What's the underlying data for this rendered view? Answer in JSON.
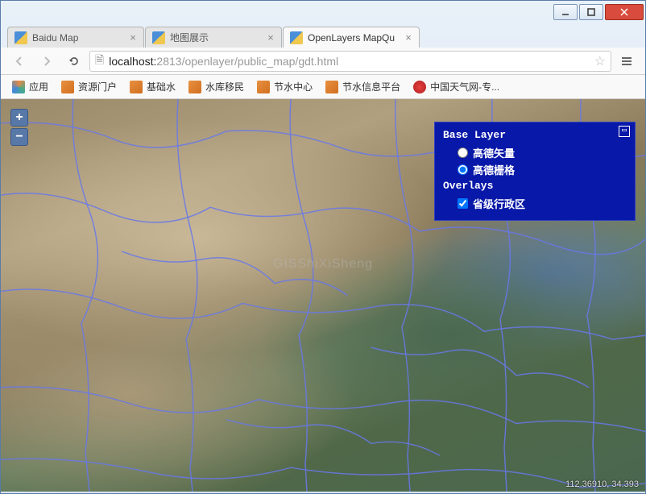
{
  "window": {
    "tabs": [
      {
        "label": "Baidu Map",
        "active": false
      },
      {
        "label": "地图展示",
        "active": false
      },
      {
        "label": "OpenLayers MapQu",
        "active": true
      }
    ]
  },
  "addressbar": {
    "host": "localhost:",
    "port_path": "2813/openlayer/public_map/gdt.html"
  },
  "bookmarks": {
    "apps_label": "应用",
    "items": [
      {
        "label": "资源门户"
      },
      {
        "label": "基础水"
      },
      {
        "label": "水库移民"
      },
      {
        "label": "节水中心"
      },
      {
        "label": "节水信息平台"
      }
    ],
    "weather": "中国天气网-专..."
  },
  "zoom": {
    "in": "+",
    "out": "−"
  },
  "layer_switcher": {
    "base_title": "Base Layer",
    "overlays_title": "Overlays",
    "base_layers": [
      {
        "label": "高德矢量",
        "selected": false
      },
      {
        "label": "高德栅格",
        "selected": true
      }
    ],
    "overlays": [
      {
        "label": "省级行政区",
        "checked": true
      }
    ],
    "collapse_glyph": "▭"
  },
  "watermark": "GISShiXiSheng",
  "coords": "112.36910, 34.393"
}
